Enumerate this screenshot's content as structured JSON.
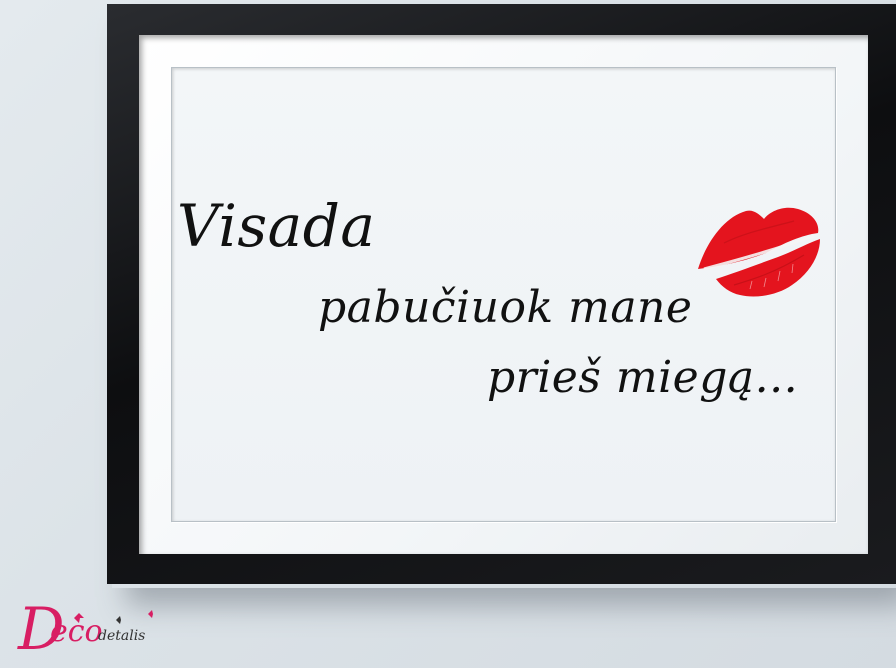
{
  "poster": {
    "line1": "Visada",
    "line2": "pabučiuok mane",
    "line3": "prieš miegą..."
  },
  "logo": {
    "initial": "D",
    "rest": "eco",
    "suffix": "detalis"
  },
  "colors": {
    "frame": "#111214",
    "mat": "#f3f6f8",
    "lips": "#e4141e",
    "logo_pink": "#d81e63"
  }
}
